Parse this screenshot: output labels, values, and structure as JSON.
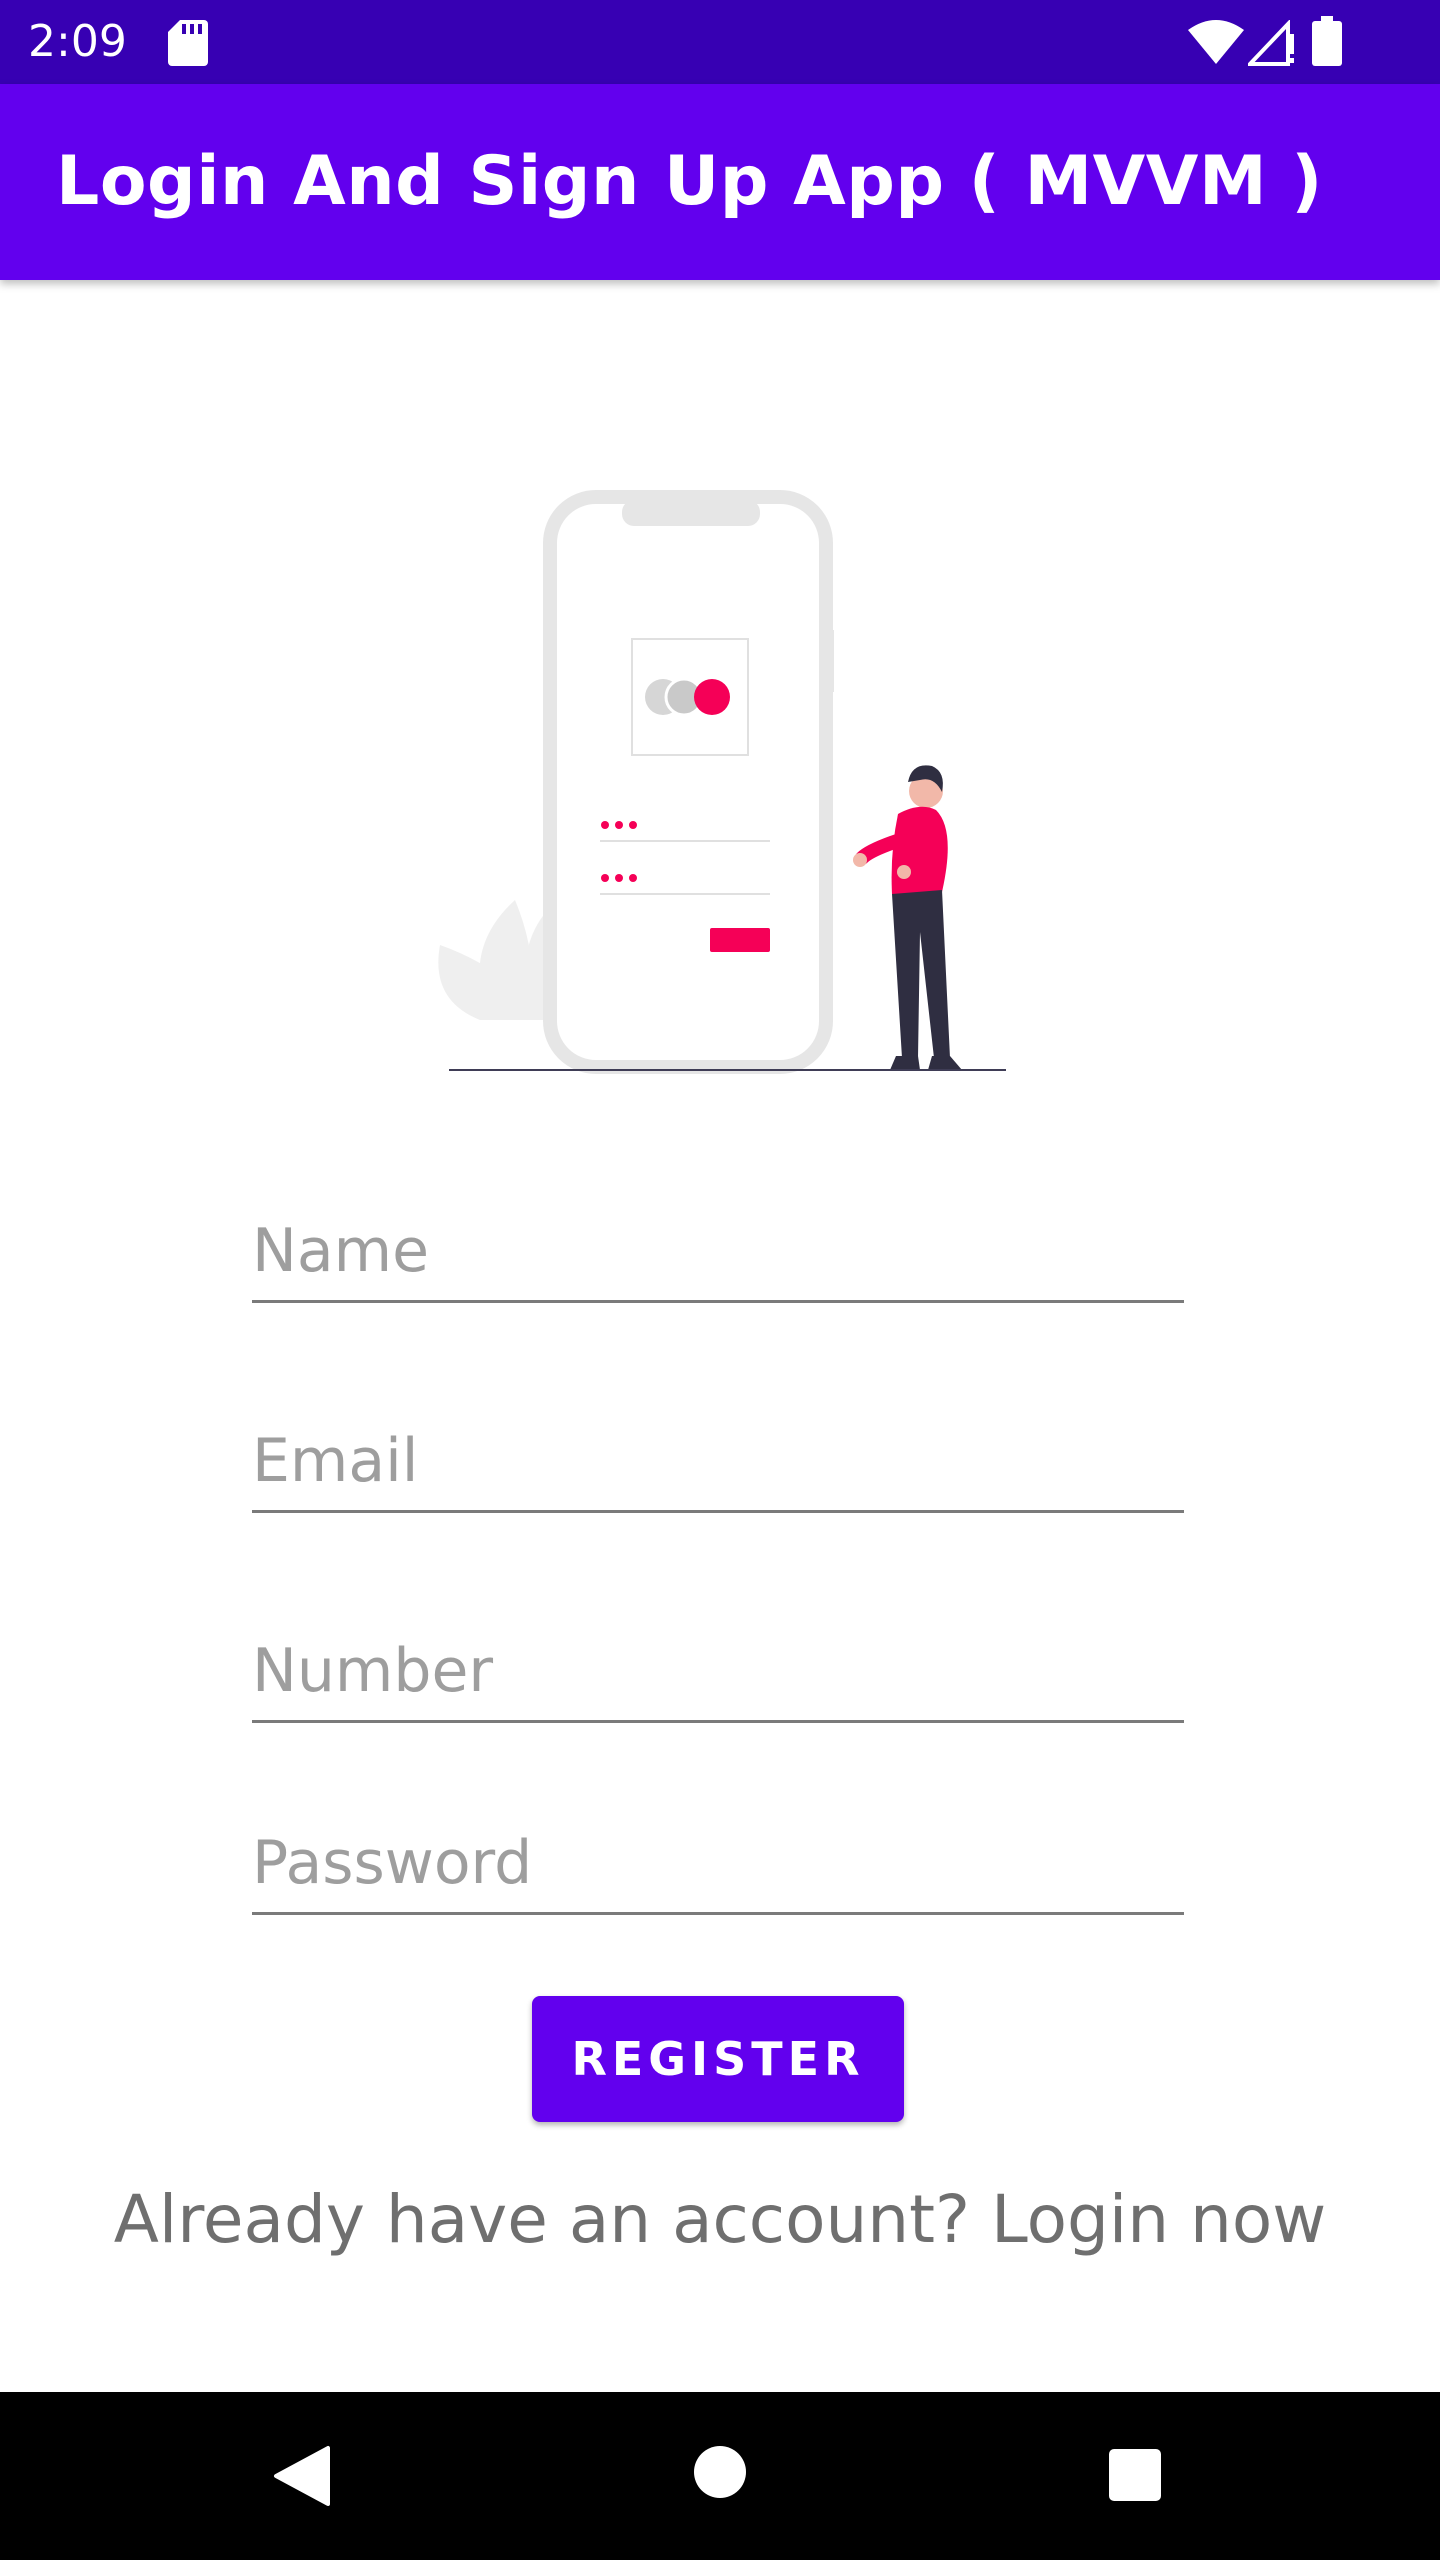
{
  "status_bar": {
    "time": "2:09",
    "icons": [
      "sd-card-icon",
      "wifi-icon",
      "signal-icon",
      "battery-icon"
    ],
    "background": "#3700B3"
  },
  "app_bar": {
    "title": "Login And Sign Up App ( MVVM )",
    "background": "#6200EE"
  },
  "illustration": {
    "name": "signup-illustration",
    "accent": "#F50057"
  },
  "form": {
    "name_placeholder": "Name",
    "email_placeholder": "Email",
    "number_placeholder": "Number",
    "password_placeholder": "Password",
    "register_label": "REGISTER"
  },
  "footer": {
    "login_prompt": "Already have an account? Login now"
  },
  "nav_bar": {
    "icons": [
      "back-icon",
      "home-icon",
      "recents-icon"
    ]
  }
}
